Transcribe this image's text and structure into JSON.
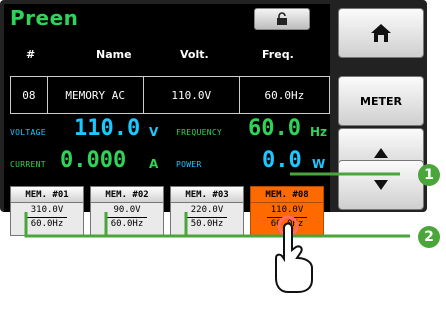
{
  "app": {
    "title": "Preen"
  },
  "table": {
    "headers": [
      "#",
      "Name",
      "Volt.",
      "Freq."
    ],
    "row": [
      "08",
      "MEMORY AC",
      "110.0V",
      "60.0Hz"
    ]
  },
  "metrics": {
    "voltage": {
      "label": "VOLTAGE",
      "value": "110.0",
      "unit": "V"
    },
    "frequency": {
      "label": "FREQUENCY",
      "value": "60.0",
      "unit": "Hz"
    },
    "current": {
      "label": "CURRENT",
      "value": "0.000",
      "unit": "A"
    },
    "power": {
      "label": "POWER",
      "value": "0.0",
      "unit": "W"
    }
  },
  "memories": [
    {
      "label": "MEM. #01",
      "volt": "310.0V",
      "freq": "60.0Hz",
      "active": false
    },
    {
      "label": "MEM. #02",
      "volt": "90.0V",
      "freq": "60.0Hz",
      "active": false
    },
    {
      "label": "MEM. #03",
      "volt": "220.0V",
      "freq": "50.0Hz",
      "active": false
    },
    {
      "label": "MEM. #08",
      "volt": "110.0V",
      "freq": "60.0Hz",
      "active": true
    }
  ],
  "side": {
    "meter_label": "METER"
  },
  "callouts": [
    "1",
    "2"
  ],
  "icons": {
    "lock": "unlock-icon",
    "home": "home-icon",
    "up": "triangle-up-icon",
    "down": "triangle-down-icon",
    "touch": "hand-pointer-icon"
  },
  "colors": {
    "green": "#2fd35a",
    "cyan": "#19c9ff",
    "orange": "#ff6a00",
    "callout": "#4aa53a"
  }
}
